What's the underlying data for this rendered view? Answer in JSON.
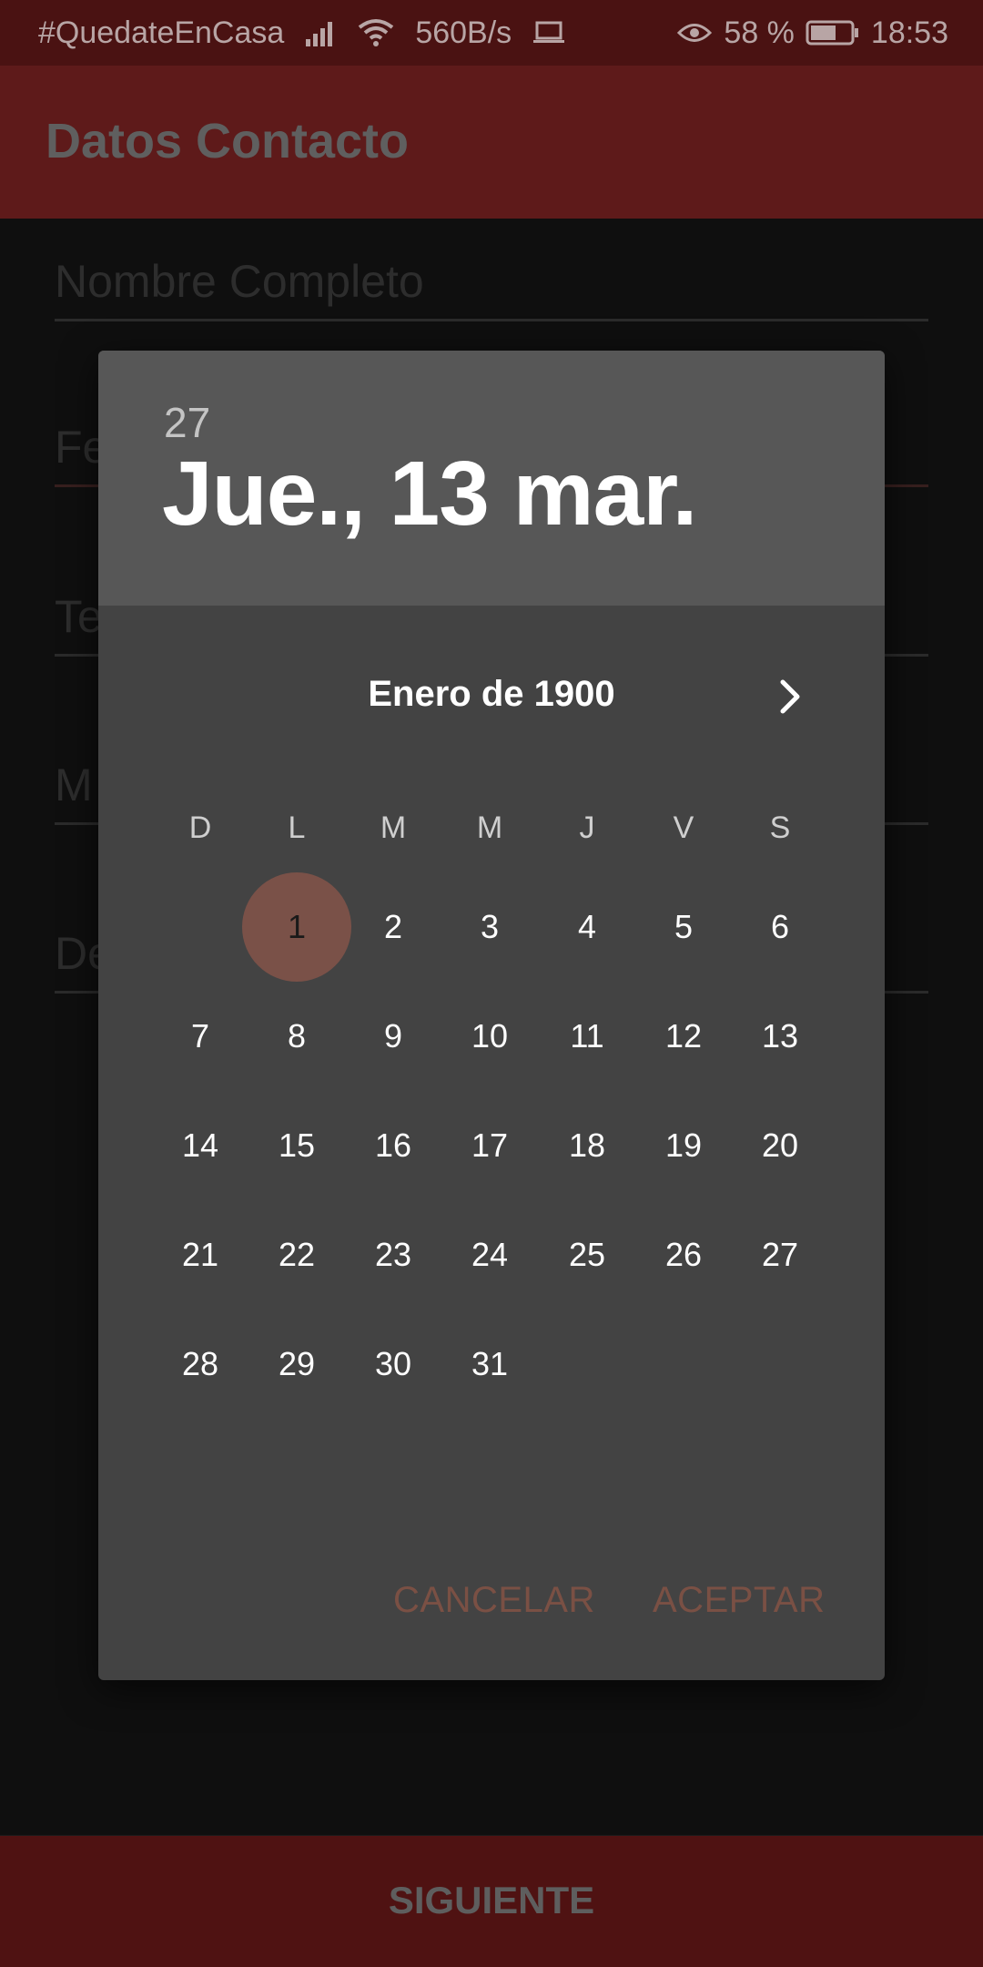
{
  "status_bar": {
    "carrier_text": "#QuedateEnCasa",
    "network_speed": "560B/s",
    "battery_percent": "58 %",
    "time": "18:53",
    "icons": [
      "signal-icon",
      "wifi-icon",
      "laptop-icon",
      "eye-icon",
      "battery-icon"
    ]
  },
  "appbar": {
    "title": "Datos Contacto"
  },
  "form": {
    "fields": [
      {
        "label": "Nombre Completo"
      },
      {
        "label": "Fe"
      },
      {
        "label": "Te"
      },
      {
        "label": "M"
      },
      {
        "label": "De"
      }
    ]
  },
  "date_picker": {
    "header_year": "27",
    "header_date": "Jue., 13 mar.",
    "month_label": "Enero de 1900",
    "weekdays": [
      "D",
      "L",
      "M",
      "M",
      "J",
      "V",
      "S"
    ],
    "days": [
      "1",
      "2",
      "3",
      "4",
      "5",
      "6",
      "7",
      "8",
      "9",
      "10",
      "11",
      "12",
      "13",
      "14",
      "15",
      "16",
      "17",
      "18",
      "19",
      "20",
      "21",
      "22",
      "23",
      "24",
      "25",
      "26",
      "27",
      "28",
      "29",
      "30",
      "31"
    ],
    "selected_day": "1",
    "cancel_label": "CANCELAR",
    "accept_label": "ACEPTAR"
  },
  "bottom": {
    "next_label": "SIGUIENTE"
  },
  "colors": {
    "status_bar": "#4a1212",
    "app_bar": "#5e1a1a",
    "dialog": "#434343",
    "dialog_header": "#575757",
    "selected_day": "#7a5148",
    "button_text": "#7a5044",
    "bottom_bar": "#4f1212"
  }
}
